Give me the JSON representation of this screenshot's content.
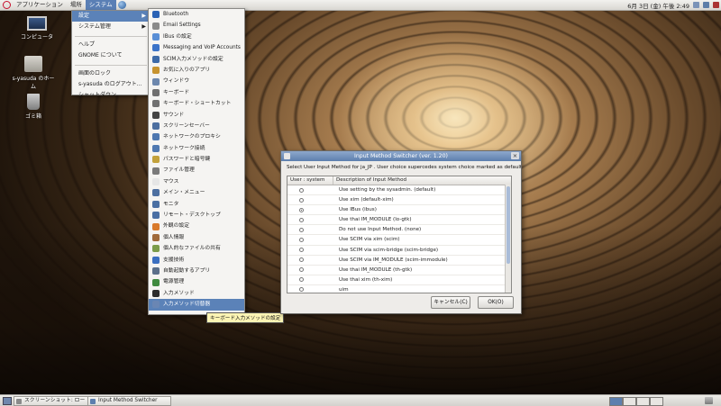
{
  "top_panel": {
    "menus": [
      "アプリケーション",
      "場所",
      "システム"
    ],
    "clock": "6月 3日 (金) 午後 2:49"
  },
  "desktop": {
    "icons": [
      "コンピュータ",
      "s-yasuda のホーム",
      "ゴミ箱"
    ]
  },
  "system_menu": {
    "items": [
      "設定",
      "システム管理",
      "ヘルプ",
      "GNOME について",
      "画面のロック",
      "s-yasuda のログアウト...",
      "シャットダウン..."
    ]
  },
  "preferences_menu": {
    "items": [
      {
        "label": "Bluetooth",
        "icon": "bluetooth-icon",
        "color": "#2a62b5"
      },
      {
        "label": "Email Settings",
        "icon": "email-icon",
        "color": "#8a8a8a"
      },
      {
        "label": "IBus の設定",
        "icon": "ibus-icon",
        "color": "#5a8fd6"
      },
      {
        "label": "Messaging and VoIP Accounts",
        "icon": "messaging-icon",
        "color": "#3b73c8"
      },
      {
        "label": "SCIM入力メソッドの設定",
        "icon": "scim-icon",
        "color": "#3d6aa8"
      },
      {
        "label": "お気に入りのアプリ",
        "icon": "favorites-icon",
        "color": "#c7932f"
      },
      {
        "label": "ウィンドウ",
        "icon": "window-icon",
        "color": "#6d87ad"
      },
      {
        "label": "キーボード",
        "icon": "keyboard-icon",
        "color": "#707070"
      },
      {
        "label": "キーボード・ショートカット",
        "icon": "keyboard-shortcut-icon",
        "color": "#707070"
      },
      {
        "label": "サウンド",
        "icon": "sound-icon",
        "color": "#444444"
      },
      {
        "label": "スクリーンセーバー",
        "icon": "screensaver-icon",
        "color": "#4d6fa0"
      },
      {
        "label": "ネットワークのプロキシ",
        "icon": "network-proxy-icon",
        "color": "#4f78b0"
      },
      {
        "label": "ネットワーク接続",
        "icon": "network-connection-icon",
        "color": "#4f78b0"
      },
      {
        "label": "パスワードと暗号鍵",
        "icon": "password-icon",
        "color": "#c2a13b"
      },
      {
        "label": "ファイル管理",
        "icon": "file-management-icon",
        "color": "#7a7a7a"
      },
      {
        "label": "マウス",
        "icon": "mouse-icon",
        "color": "#e6e6e6"
      },
      {
        "label": "メイン・メニュー",
        "icon": "main-menu-icon",
        "color": "#4d6fa0"
      },
      {
        "label": "モニタ",
        "icon": "monitor-icon",
        "color": "#4a6fa3"
      },
      {
        "label": "リモート・デスクトップ",
        "icon": "remote-desktop-icon",
        "color": "#4a6fa3"
      },
      {
        "label": "外観の設定",
        "icon": "appearance-icon",
        "color": "#d97a2b"
      },
      {
        "label": "個人情報",
        "icon": "personal-info-icon",
        "color": "#a06a3a"
      },
      {
        "label": "個人的なファイルの共有",
        "icon": "file-sharing-icon",
        "color": "#7c9c4a"
      },
      {
        "label": "支援技術",
        "icon": "accessibility-icon",
        "color": "#3b6fc0"
      },
      {
        "label": "自動起動するアプリ",
        "icon": "startup-apps-icon",
        "color": "#5b6f8a"
      },
      {
        "label": "電源管理",
        "icon": "power-icon",
        "color": "#3f8a3f"
      },
      {
        "label": "入力メソッド",
        "icon": "input-method-icon",
        "color": "#2c2c2c"
      },
      {
        "label": "入力メソッド切替器",
        "icon": "im-switcher-icon",
        "color": "#6a86b3"
      }
    ],
    "highlighted_index": 26
  },
  "tooltip": "キーボード入力メソッドの設定",
  "dialog": {
    "title": "Input Method Switcher (ver. 1.20)",
    "description": "Select User Input Method for ja_JP . User choice supercedes system choice marked as default.",
    "columns": [
      "User : system",
      "Description of Input Method"
    ],
    "rows": [
      {
        "desc": "Use setting by the sysadmin. (default)",
        "selected": false
      },
      {
        "desc": "Use xim (default-xim)",
        "selected": false
      },
      {
        "desc": "Use IBus (ibus)",
        "selected": true
      },
      {
        "desc": "Use thai IM_MODULE (lo-gtk)",
        "selected": false
      },
      {
        "desc": "Do not use Input Method. (none)",
        "selected": false
      },
      {
        "desc": "Use SCIM via xim (scim)",
        "selected": false
      },
      {
        "desc": "Use SCIM via scim-bridge (scim-bridge)",
        "selected": false
      },
      {
        "desc": "Use SCIM via IM_MODULE (scim-immodule)",
        "selected": false
      },
      {
        "desc": "Use thai IM_MODULE (th-gtk)",
        "selected": false
      },
      {
        "desc": "Use thai xim (th-xim)",
        "selected": false
      },
      {
        "desc": "uim",
        "selected": false
      }
    ],
    "cancel_label": "キャンセル(C)",
    "ok_label": "OK(O)"
  },
  "bottom_panel": {
    "tasks": [
      "スクリーンショット: ロー",
      "Input Method Switcher"
    ]
  }
}
